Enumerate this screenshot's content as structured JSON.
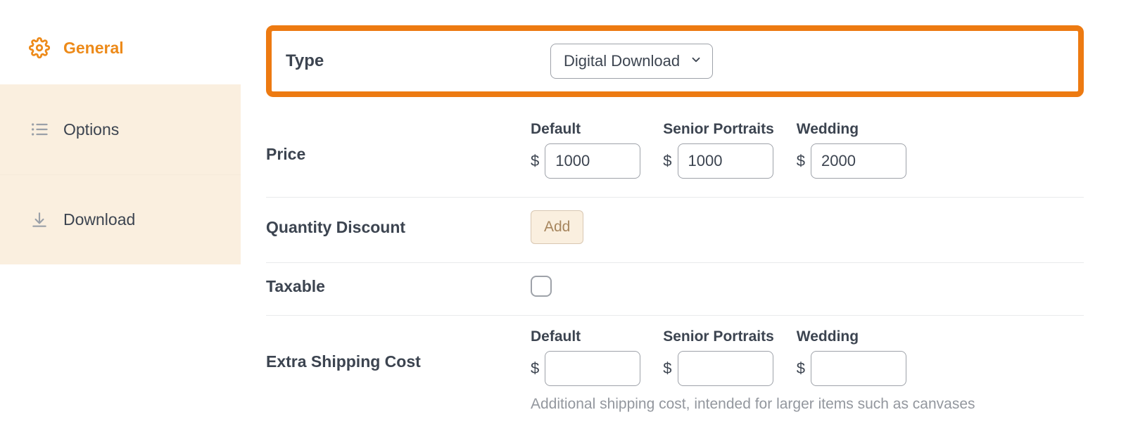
{
  "sidebar": {
    "general": "General",
    "options": "Options",
    "download": "Download"
  },
  "form": {
    "type": {
      "label": "Type",
      "value": "Digital Download"
    },
    "price": {
      "label": "Price",
      "columns": [
        {
          "name": "Default",
          "value": "1000"
        },
        {
          "name": "Senior Portraits",
          "value": "1000"
        },
        {
          "name": "Wedding",
          "value": "2000"
        }
      ]
    },
    "quantity_discount": {
      "label": "Quantity Discount",
      "add_label": "Add"
    },
    "taxable": {
      "label": "Taxable"
    },
    "extra_shipping": {
      "label": "Extra Shipping Cost",
      "columns": [
        {
          "name": "Default",
          "value": ""
        },
        {
          "name": "Senior Portraits",
          "value": ""
        },
        {
          "name": "Wedding",
          "value": ""
        }
      ],
      "hint": "Additional shipping cost, intended for larger items such as canvases"
    },
    "currency_symbol": "$"
  }
}
